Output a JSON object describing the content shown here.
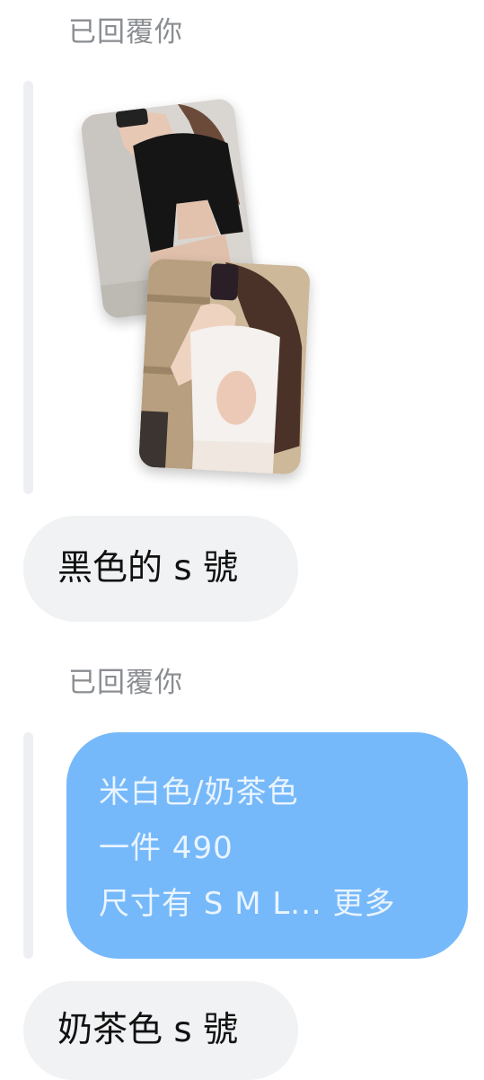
{
  "thread": {
    "reply_label_1": "已回覆你",
    "reply_label_2": "已回覆你",
    "msg_gray_1": "黑色的 s 號",
    "blue_line_1": "米白色/奶茶色",
    "blue_line_2": "一件 490",
    "blue_line_3_text": "尺寸有 S M L... ",
    "blue_more": "更多",
    "msg_gray_2": "奶茶色 s 號"
  },
  "colors": {
    "reply_bar": "#eeeff2",
    "gray_bubble": "#f1f2f4",
    "blue_bubble": "#76b9fa",
    "reply_label": "#8a8d91"
  },
  "images": [
    {
      "name": "black-top-photo",
      "description_icon": "photo-icon"
    },
    {
      "name": "white-top-photo",
      "description_icon": "photo-icon"
    }
  ]
}
